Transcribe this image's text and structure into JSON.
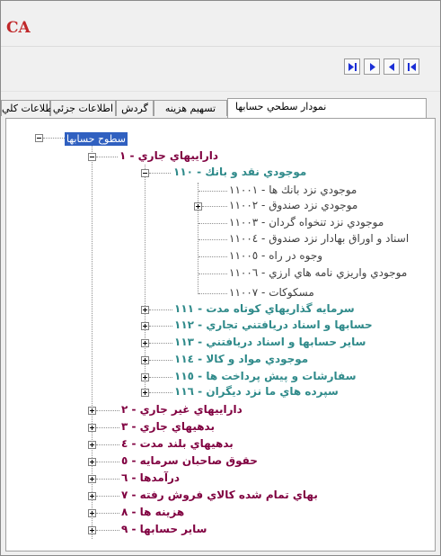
{
  "app": {
    "logo_text": "CA"
  },
  "navigation": {
    "buttons": [
      {
        "name": "first-record-button",
        "icon": "skip-to-last-icon"
      },
      {
        "name": "next-record-button",
        "icon": "play-right-icon"
      },
      {
        "name": "prev-record-button",
        "icon": "play-left-icon"
      },
      {
        "name": "last-record-button",
        "icon": "skip-to-first-icon"
      }
    ],
    "accent_color": "#1c2fd6"
  },
  "tabs": [
    {
      "label": "نمودار سطحي حسابها",
      "active": true
    },
    {
      "label": "تسهيم هزينه",
      "active": false
    },
    {
      "label": "گردش",
      "active": false
    },
    {
      "label": "اطلاعات جزئي",
      "active": false
    },
    {
      "label": "اطلاعات كلي",
      "active": false
    }
  ],
  "tree": {
    "root": {
      "label": "سطوح حسابها",
      "expanded": true
    },
    "level1": [
      {
        "label": "داراييهاي جاري - ١",
        "expanded": true
      },
      {
        "label": "داراييهاي غير جاري - ٢",
        "expanded": false
      },
      {
        "label": "بدهيهاي جاري - ٣",
        "expanded": false
      },
      {
        "label": "بدهيهاي بلند مدت - ٤",
        "expanded": false
      },
      {
        "label": "حقوق صاحبان سرمايه - ٥",
        "expanded": false
      },
      {
        "label": "درآمدها - ٦",
        "expanded": false
      },
      {
        "label": "بهاي تمام شده كالاي فروش رفته - ٧",
        "expanded": false
      },
      {
        "label": "هزينه ها - ٨",
        "expanded": false
      },
      {
        "label": "ساير حسابها - ٩",
        "expanded": false
      }
    ],
    "level2": [
      {
        "label": "موجودي نقد و بانك - ١١٠",
        "expanded": true
      },
      {
        "label": "سرمايه گذاريهاي كوتاه مدت - ١١١",
        "expanded": false
      },
      {
        "label": "حسابها و اسناد دريافتني تجاري - ١١٢",
        "expanded": false
      },
      {
        "label": "ساير حسابها و اسناد دريافتني - ١١٣",
        "expanded": false
      },
      {
        "label": "موجودي مواد و كالا - ١١٤",
        "expanded": false
      },
      {
        "label": "سفارشات و پيش پرداخت ها - ١١٥",
        "expanded": false
      },
      {
        "label": "سپرده هاي ما نزد ديگران - ١١٦",
        "expanded": false
      }
    ],
    "level3": [
      {
        "label": "موجودي نزد بانك ها - ١١٠٠١",
        "expander": false
      },
      {
        "label": "موجودي نزد صندوق - ١١٠٠٢",
        "expander": true
      },
      {
        "label": "موجودي نزد تنخواه گردان - ١١٠٠٣",
        "expander": false
      },
      {
        "label": "اسناد و اوراق بهادار نزد صندوق - ١١٠٠٤",
        "expander": false
      },
      {
        "label": "وجوه در راه - ١١٠٠٥",
        "expander": false
      },
      {
        "label": "موجودي واريزي نامه هاي ارزي - ١١٠٠٦",
        "expander": false
      },
      {
        "label": "مسكوكات - ١١٠٠٧",
        "expander": false
      }
    ]
  }
}
